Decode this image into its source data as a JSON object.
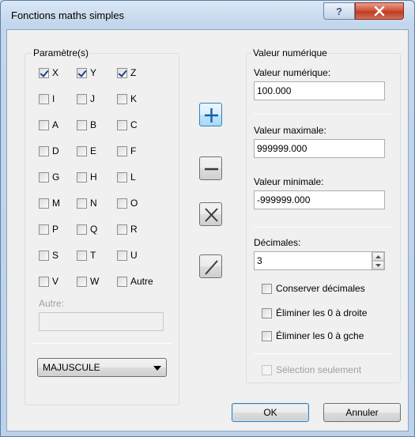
{
  "window": {
    "title": "Fonctions maths simples",
    "help_icon": "?"
  },
  "parametres": {
    "legend": "Paramètre(s)",
    "rows": [
      [
        {
          "label": "X",
          "checked": true
        },
        {
          "label": "Y",
          "checked": true
        },
        {
          "label": "Z",
          "checked": true
        }
      ],
      [
        {
          "label": "I",
          "checked": false
        },
        {
          "label": "J",
          "checked": false
        },
        {
          "label": "K",
          "checked": false
        }
      ],
      [
        {
          "label": "A",
          "checked": false
        },
        {
          "label": "B",
          "checked": false
        },
        {
          "label": "C",
          "checked": false
        }
      ],
      [
        {
          "label": "D",
          "checked": false
        },
        {
          "label": "E",
          "checked": false
        },
        {
          "label": "F",
          "checked": false
        }
      ],
      [
        {
          "label": "G",
          "checked": false
        },
        {
          "label": "H",
          "checked": false
        },
        {
          "label": "L",
          "checked": false
        }
      ],
      [
        {
          "label": "M",
          "checked": false
        },
        {
          "label": "N",
          "checked": false
        },
        {
          "label": "O",
          "checked": false
        }
      ],
      [
        {
          "label": "P",
          "checked": false
        },
        {
          "label": "Q",
          "checked": false
        },
        {
          "label": "R",
          "checked": false
        }
      ],
      [
        {
          "label": "S",
          "checked": false
        },
        {
          "label": "T",
          "checked": false
        },
        {
          "label": "U",
          "checked": false
        }
      ],
      [
        {
          "label": "V",
          "checked": false
        },
        {
          "label": "W",
          "checked": false
        },
        {
          "label": "Autre",
          "checked": false
        }
      ]
    ],
    "autre_label": "Autre:",
    "autre_value": "",
    "case_select": "MAJUSCULE"
  },
  "operations": [
    "plus-icon",
    "minus-icon",
    "multiply-icon",
    "divide-icon"
  ],
  "valeur": {
    "legend": "Valeur numérique",
    "valeur_label": "Valeur numérique:",
    "valeur_value": "100.000",
    "max_label": "Valeur maximale:",
    "max_value": "999999.000",
    "min_label": "Valeur minimale:",
    "min_value": "-999999.000",
    "decimales_label": "Décimales:",
    "decimales_value": "3",
    "conserver_label": "Conserver décimales",
    "eliminer_droite_label": "Éliminer les 0 à droite",
    "eliminer_gauche_label": "Éliminer les 0 à gche",
    "selection_label": "Sélection seulement"
  },
  "buttons": {
    "ok": "OK",
    "cancel": "Annuler"
  }
}
